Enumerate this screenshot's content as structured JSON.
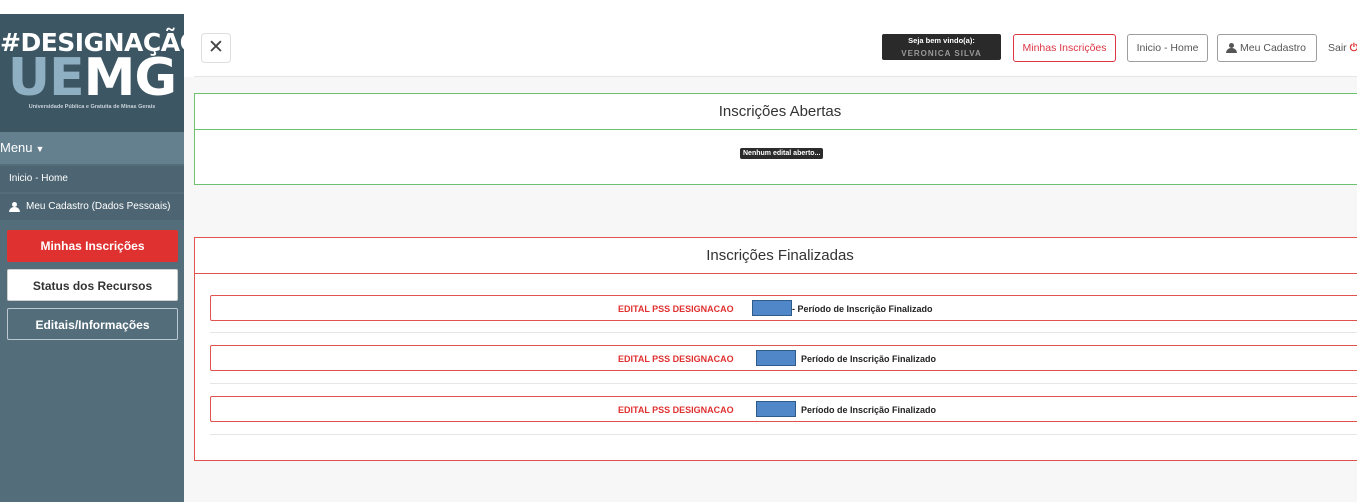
{
  "sidebar": {
    "logo_line1": "#DESIGNAÇÃO",
    "logo_line2_a": "UE",
    "logo_line2_b": "MG",
    "logo_tagline": "Universidade Pública e Gratuita de Minas Gerais",
    "menu_label": "Menu",
    "sub_items": [
      "Inicio - Home",
      "Meu Cadastro (Dados Pessoais)"
    ],
    "buttons": [
      "Minhas Inscrições",
      "Status dos Recursos",
      "Editais/Informações"
    ]
  },
  "topnav": {
    "welcome_title": "Seja bem vindo(a):",
    "welcome_user": "VERONICA SILVA SEVERINO",
    "minhas_inscricoes": "Minhas Inscrições",
    "inicio_home": "Inicio - Home",
    "meu_cadastro": "Meu Cadastro",
    "sair": "Sair"
  },
  "abertas": {
    "title": "Inscrições Abertas",
    "empty_message": "Nenhum edital aberto..."
  },
  "finalizadas": {
    "title": "Inscrições Finalizadas",
    "rows": [
      {
        "edital": "EDITAL PSS DESIGNACAO",
        "status": "- Período de Inscrição Finalizado"
      },
      {
        "edital": "EDITAL PSS DESIGNACAO",
        "status": "Período de Inscrição Finalizado"
      },
      {
        "edital": "EDITAL PSS DESIGNACAO",
        "status": "Período de Inscrição Finalizado"
      }
    ]
  },
  "colors": {
    "sidebar": "#536d7b",
    "accent_red": "#e03131",
    "success_green": "#6cc26e",
    "redaction_blue": "#4f87c9"
  }
}
